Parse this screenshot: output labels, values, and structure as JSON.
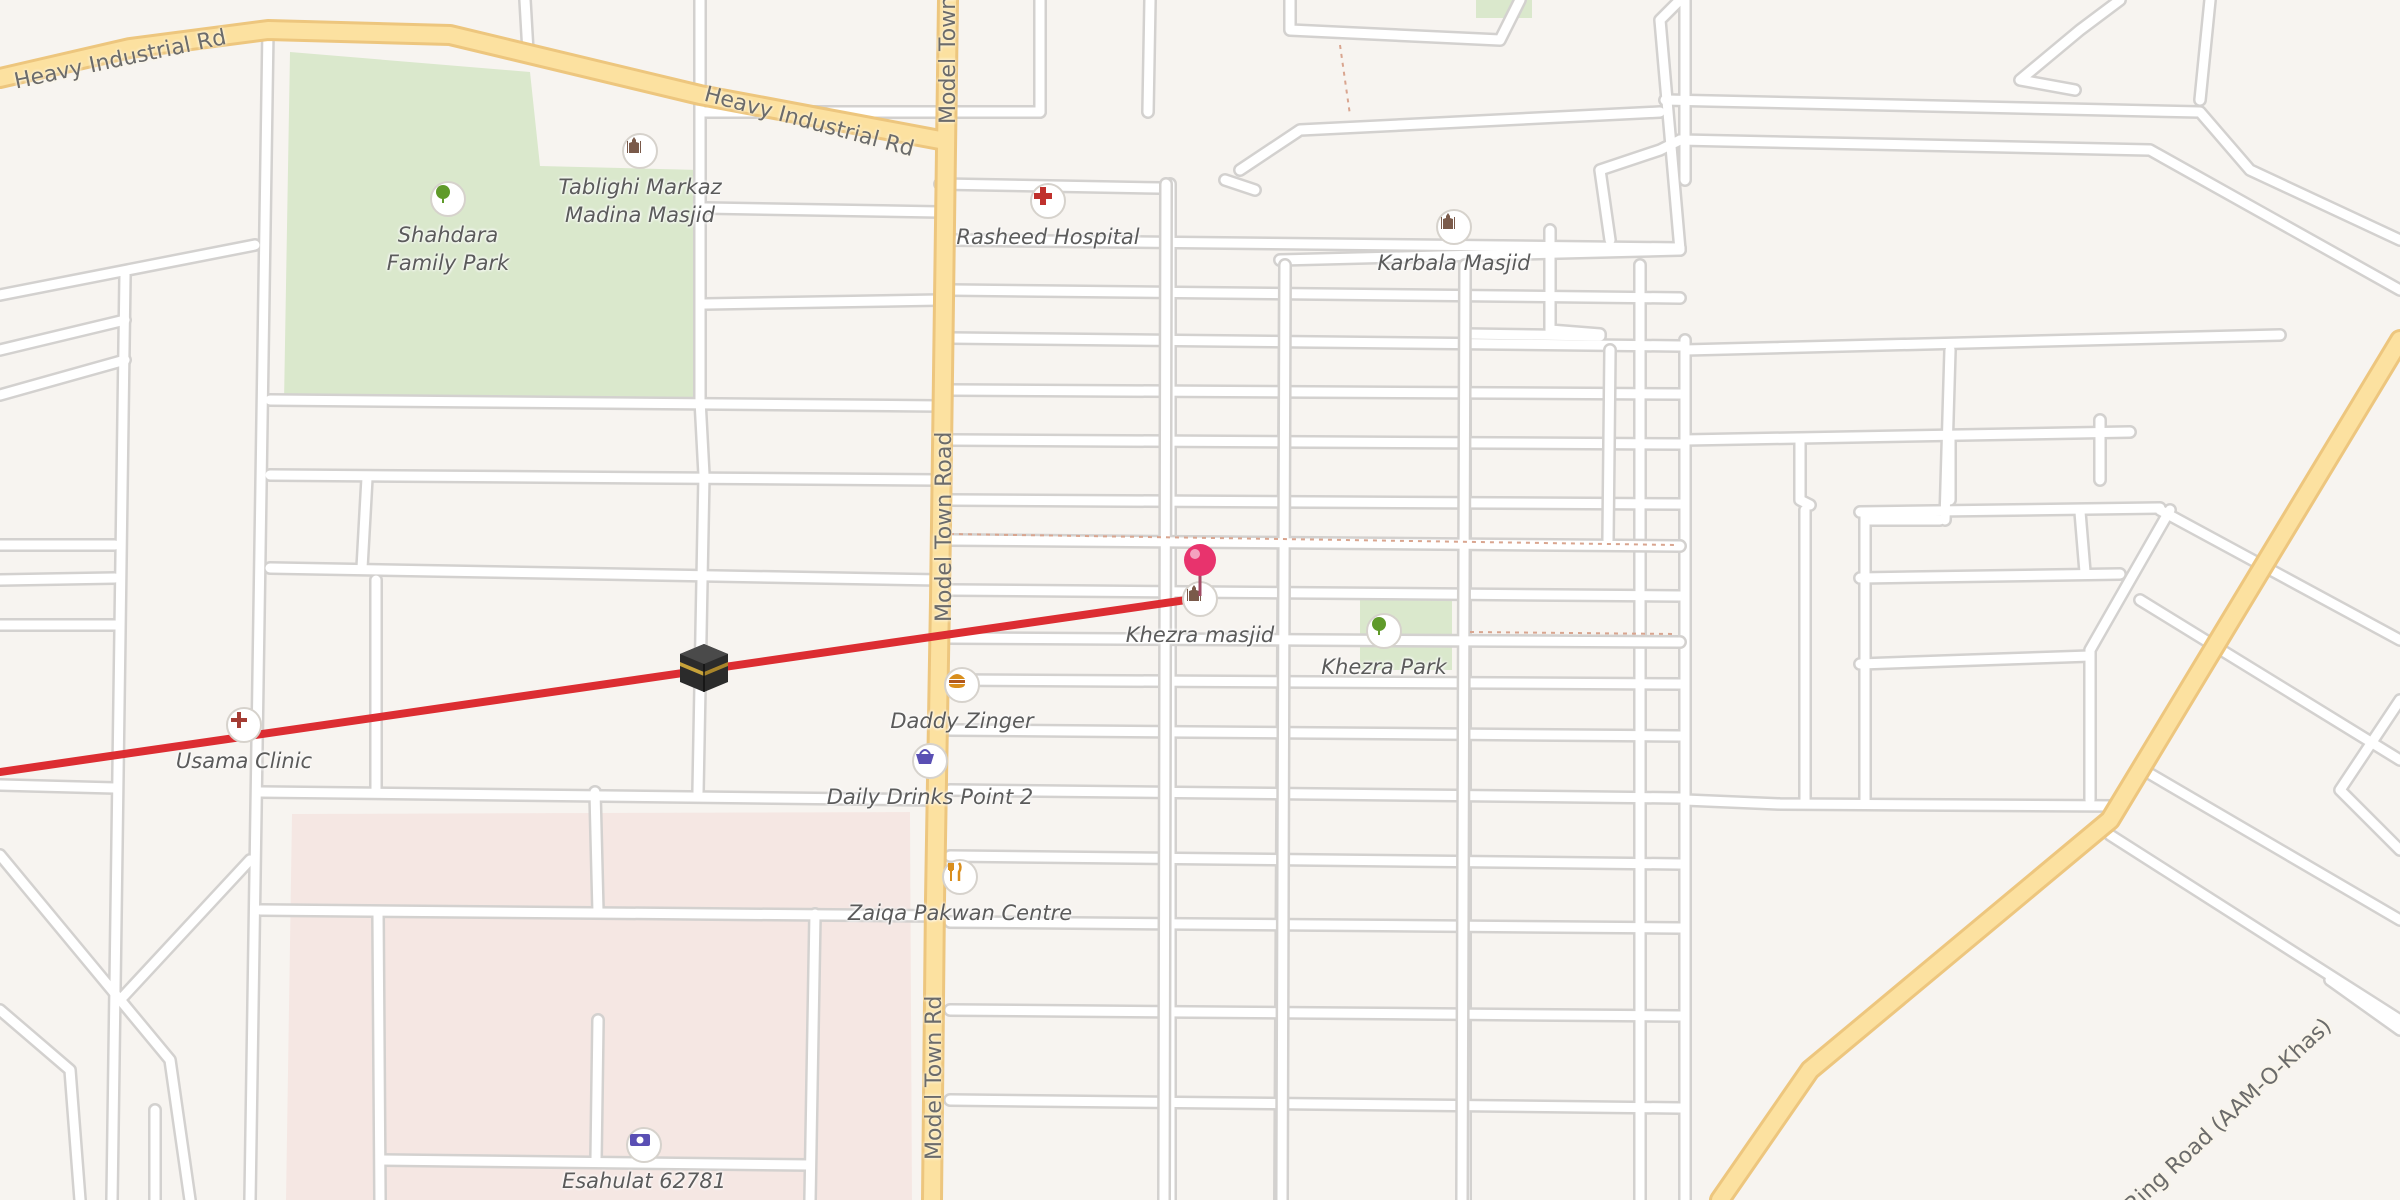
{
  "map": {
    "road_labels": {
      "heavy_industrial_west": "Heavy Industrial Rd",
      "heavy_industrial_east": "Heavy Industrial Rd",
      "model_town_top": "Model Town Road",
      "model_town_middle": "Model Town Road",
      "model_town_bottom": "Model Town Rd",
      "aam_o_khas": "Ring Road (AAM-O-Khas)"
    },
    "pois": {
      "tablighi_markaz": {
        "label": "Tablighi Markaz\nMadina Masjid",
        "icon": "mosque-icon"
      },
      "shahdara_park": {
        "label": "Shahdara\nFamily Park",
        "icon": "park-tree-icon"
      },
      "rasheed_hospital": {
        "label": "Rasheed Hospital",
        "icon": "hospital-cross-icon"
      },
      "karbala_masjid": {
        "label": "Karbala Masjid",
        "icon": "mosque-icon"
      },
      "khezra_masjid": {
        "label": "Khezra masjid",
        "icon": "mosque-icon"
      },
      "khezra_park": {
        "label": "Khezra Park",
        "icon": "park-tree-icon"
      },
      "daddy_zinger": {
        "label": "Daddy Zinger",
        "icon": "fast-food-icon"
      },
      "daily_drinks": {
        "label": "Daily Drinks Point 2",
        "icon": "shopping-basket-icon"
      },
      "usama_clinic": {
        "label": "Usama Clinic",
        "icon": "clinic-cross-icon"
      },
      "zaiqa_pakwan": {
        "label": "Zaiqa Pakwan Centre",
        "icon": "restaurant-icon"
      },
      "esahulat": {
        "label": "Esahulat 62781",
        "icon": "atm-money-icon"
      }
    },
    "markers": {
      "selected_location": {
        "icon": "location-pin-icon",
        "color": "#e8336d"
      },
      "qibla": {
        "icon": "kaaba-icon"
      }
    },
    "colors": {
      "land": "#f7f4f0",
      "park": "#dae8cc",
      "residential": "#f5e7e3",
      "major_road": "#fce1a0",
      "major_road_casing": "#edc67e",
      "street": "#ffffff",
      "street_casing": "#d3d1cf",
      "qibla_line": "#dc2d32"
    }
  }
}
